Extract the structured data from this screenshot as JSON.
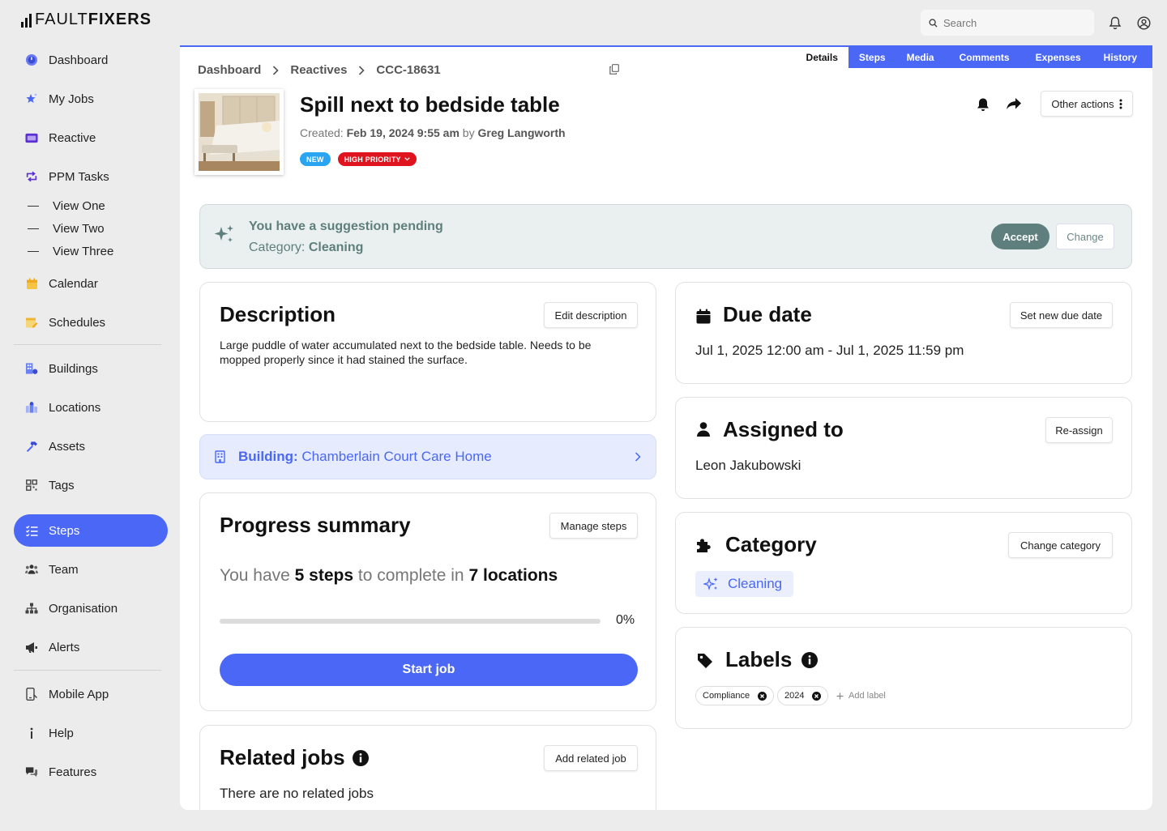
{
  "app": {
    "logo_light": "FAULT",
    "logo_bold": "FIXERS",
    "search_placeholder": "Search"
  },
  "sidebar": {
    "items": [
      {
        "label": "Dashboard",
        "icon": "clock-icon"
      },
      {
        "label": "My Jobs",
        "icon": "star-sparkle-icon"
      },
      {
        "label": "Reactive",
        "icon": "ticket-icon"
      },
      {
        "label": "PPM Tasks",
        "icon": "repeat-arrows-icon"
      },
      {
        "label": "Calendar",
        "icon": "calendar-icon"
      },
      {
        "label": "Schedules",
        "icon": "schedule-icon"
      },
      {
        "label": "Buildings",
        "icon": "building-icon"
      },
      {
        "label": "Locations",
        "icon": "location-icon"
      },
      {
        "label": "Assets",
        "icon": "hammer-icon"
      },
      {
        "label": "Tags",
        "icon": "qr-code-icon"
      },
      {
        "label": "Steps",
        "icon": "list-check-icon"
      },
      {
        "label": "Team",
        "icon": "team-icon"
      },
      {
        "label": "Organisation",
        "icon": "org-chart-icon"
      },
      {
        "label": "Alerts",
        "icon": "megaphone-icon"
      },
      {
        "label": "Mobile App",
        "icon": "mobile-icon"
      },
      {
        "label": "Help",
        "icon": "info-icon"
      },
      {
        "label": "Features",
        "icon": "chat-icon"
      }
    ],
    "sub_items": [
      "View One",
      "View Two",
      "View Three"
    ],
    "active": "Steps"
  },
  "tabs": [
    "Details",
    "Steps",
    "Media",
    "Comments",
    "Expenses",
    "History"
  ],
  "active_tab": "Details",
  "breadcrumb": {
    "items": [
      "Dashboard",
      "Reactives",
      "CCC-18631"
    ]
  },
  "job": {
    "title": "Spill next to bedside table",
    "created_label": "Created:",
    "created_date": "Feb 19, 2024 9:55 am",
    "by_label": "by",
    "created_by": "Greg Langworth",
    "badge_new": "NEW",
    "badge_priority": "HIGH PRIORITY",
    "other_actions": "Other actions"
  },
  "suggestion": {
    "heading": "You have a suggestion pending",
    "category_label": "Category:",
    "category_value": "Cleaning",
    "accept": "Accept",
    "change": "Change"
  },
  "description": {
    "title": "Description",
    "button": "Edit description",
    "text": "Large puddle of water accumulated next to the bedside table. Needs to be mopped properly since it had stained the surface."
  },
  "building": {
    "label": "Building:",
    "value": "Chamberlain Court Care Home"
  },
  "progress": {
    "title": "Progress summary",
    "button": "Manage steps",
    "text_1": "You have",
    "steps_count": "5 steps",
    "text_2": "to complete in",
    "locations_count": "7 locations",
    "percent": 0,
    "percent_label": "0%",
    "start_button": "Start job"
  },
  "related": {
    "title": "Related jobs",
    "button": "Add related job",
    "empty_text": "There are no related jobs"
  },
  "due_date": {
    "title": "Due date",
    "button": "Set new due date",
    "value": "Jul 1, 2025 12:00 am - Jul 1, 2025 11:59 pm"
  },
  "assigned": {
    "title": "Assigned to",
    "button": "Re-assign",
    "value": "Leon Jakubowski"
  },
  "category": {
    "title": "Category",
    "button": "Change category",
    "value": "Cleaning"
  },
  "labels": {
    "title": "Labels",
    "items": [
      "Compliance",
      "2024"
    ],
    "add_label": "Add label"
  },
  "colors": {
    "accent": "#4a67f5",
    "suggestion_text": "#5f7f7d",
    "badge_new": "#2aa5f2",
    "badge_high": "#e0141e"
  }
}
